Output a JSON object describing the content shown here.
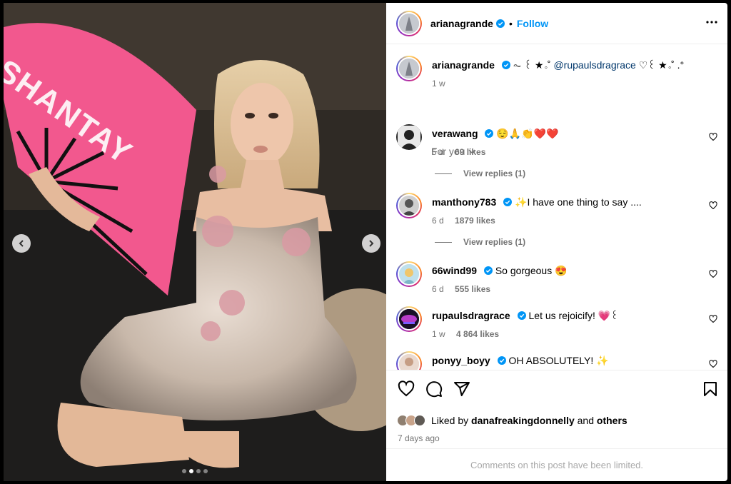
{
  "post": {
    "username": "arianagrande",
    "separator": "•",
    "follow_label": "Follow",
    "fan_text": "SHANTAY",
    "carousel_dots": 4,
    "carousel_active": 1
  },
  "caption": {
    "username": "arianagrande",
    "prefix": "⏦ ꒰ ★｡˚",
    "mention": "@rupaulsdragrace",
    "suffix": "♡꒰ ★｡˚ .°",
    "time": "1 w"
  },
  "sort": {
    "label": "For you"
  },
  "comments": [
    {
      "username": "verawang",
      "text": "😌🙏👏❤️❤️",
      "time": "5 d",
      "likes": "69 likes",
      "replies": "View replies (1)"
    },
    {
      "username": "manthony783",
      "text": "✨I have one thing to say ....",
      "time": "6 d",
      "likes": "1879 likes",
      "replies": "View replies (1)"
    },
    {
      "username": "66wind99",
      "text": "So gorgeous 😍",
      "time": "6 d",
      "likes": "555 likes"
    },
    {
      "username": "rupaulsdragrace",
      "text": "Let us rejoicify! 💗꒰",
      "time": "1 w",
      "likes": "4 864 likes"
    },
    {
      "username": "ponyy_boyy",
      "text": "OH ABSOLUTELY! ✨"
    }
  ],
  "likes": {
    "prefix": "Liked by",
    "user": "danafreakingdonnelly",
    "conj": "and",
    "others": "others",
    "date": "7 days ago"
  },
  "footer": {
    "limited": "Comments on this post have been limited."
  },
  "colors": {
    "accent": "#0095f6",
    "verified": "#0095f6",
    "fan": "#f2588e"
  }
}
